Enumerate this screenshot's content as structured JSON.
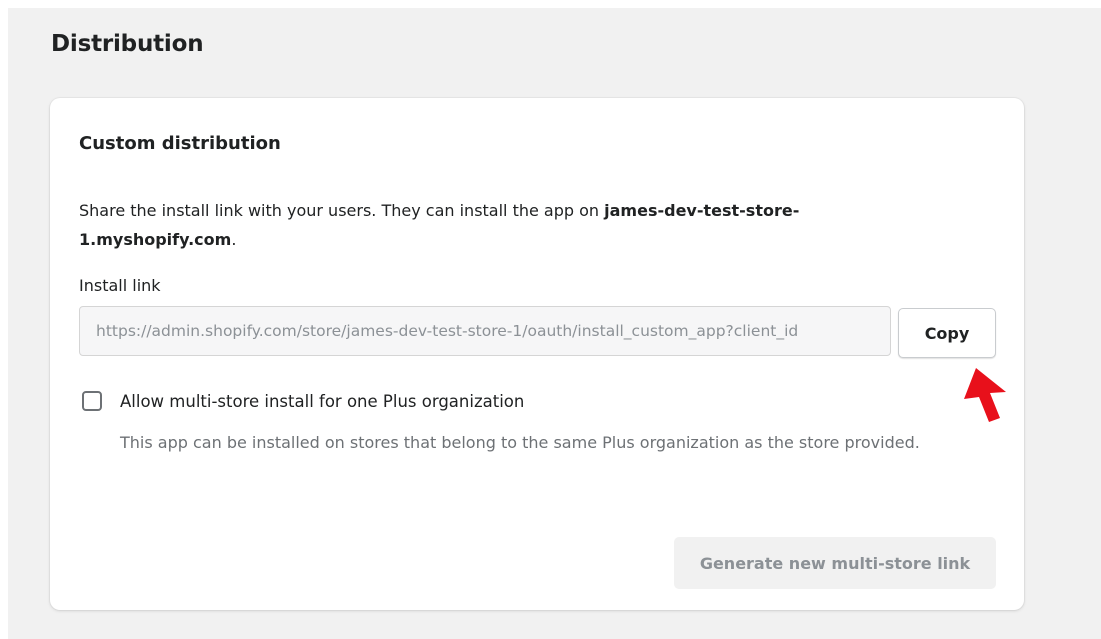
{
  "page": {
    "title": "Distribution"
  },
  "card": {
    "title": "Custom distribution",
    "description_prefix": "Share the install link with your users. They can install the app on ",
    "store_domain": "james-dev-test-store-1.myshopify.com",
    "description_suffix": ".",
    "install_link_label": "Install link",
    "install_link_value": "https://admin.shopify.com/store/james-dev-test-store-1/oauth/install_custom_app?client_id",
    "copy_button_label": "Copy",
    "multi_store_checkbox_label": "Allow multi-store install for one Plus organization",
    "multi_store_checked": false,
    "multi_store_help_text": "This app can be installed on stores that belong to the same Plus organization as the store provided.",
    "generate_button_label": "Generate new multi-store link"
  },
  "annotation": {
    "arrow_icon": "red-arrow-icon",
    "arrow_color": "#e8101b"
  },
  "colors": {
    "background": "#f1f1f1",
    "card": "#ffffff",
    "text": "#202223",
    "subdued_text": "#6d7175",
    "disabled_text": "#8c9196"
  }
}
